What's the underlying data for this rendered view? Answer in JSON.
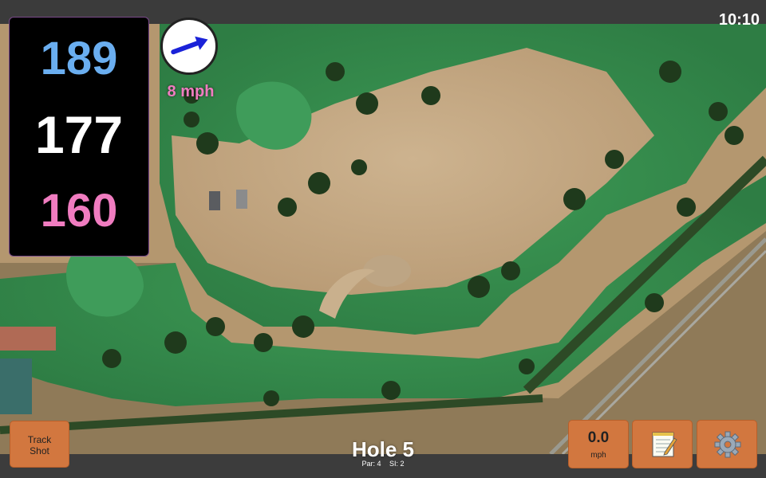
{
  "status_bar": {
    "time": "10:10"
  },
  "yardages": {
    "back": "189",
    "middle": "177",
    "front": "160",
    "colors": {
      "back": "#6aaef0",
      "middle": "#ffffff",
      "front": "#f07cc0"
    }
  },
  "wind": {
    "speed_label": "8 mph",
    "arrow_icon": "wind-direction-arrow-icon",
    "arrow_color": "#1a22d8",
    "label_color": "#f07cc0"
  },
  "hole": {
    "title": "Hole 5",
    "par": "Par: 4",
    "stroke_index": "SI: 2"
  },
  "buttons": {
    "track_shot_line1": "Track",
    "track_shot_line2": "Shot",
    "speed_value": "0.0",
    "speed_unit": "mph",
    "notes_icon": "notepad-icon",
    "settings_icon": "gear-icon",
    "accent": "#d2773f"
  }
}
